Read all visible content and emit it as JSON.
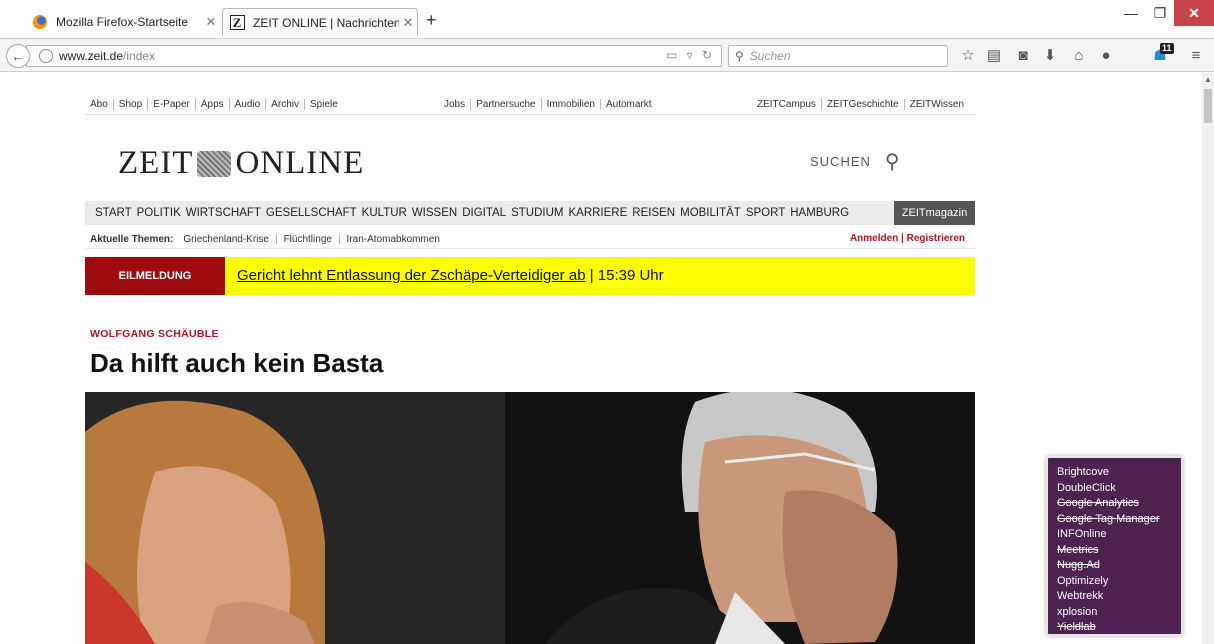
{
  "browser": {
    "tabs": [
      {
        "title": "Mozilla Firefox-Startseite",
        "active": false
      },
      {
        "title": "ZEIT ONLINE | Nachrichten...",
        "active": true
      }
    ],
    "url_host": "www.zeit.de",
    "url_path": "/index",
    "search_placeholder": "Suchen",
    "notification_count": "11",
    "icons": [
      "back-arrow-icon",
      "globe-icon",
      "reader-icon",
      "reload-icon",
      "bookmark-star-icon",
      "bookmarks-list-icon",
      "pocket-icon",
      "download-icon",
      "home-icon",
      "chat-icon",
      "ghostery-icon",
      "menu-icon"
    ]
  },
  "site": {
    "top_links_left": [
      "Abo",
      "Shop",
      "E-Paper",
      "Apps",
      "Audio",
      "Archiv",
      "Spiele"
    ],
    "top_links_middle": [
      "Jobs",
      "Partnersuche",
      "Immobilien",
      "Automarkt"
    ],
    "top_links_right": [
      "ZEITCampus",
      "ZEITGeschichte",
      "ZEITWissen"
    ],
    "logo_left": "ZEIT",
    "logo_right": "ONLINE",
    "search_label": "SUCHEN",
    "sections": [
      "START",
      "POLITIK",
      "WIRTSCHAFT",
      "GESELLSCHAFT",
      "KULTUR",
      "WISSEN",
      "DIGITAL",
      "STUDIUM",
      "KARRIERE",
      "REISEN",
      "MOBILITÄT",
      "SPORT",
      "HAMBURG"
    ],
    "zeitmagazin": "ZEITmagazin",
    "topics_label": "Aktuelle Themen:",
    "topics": [
      "Griechenland-Krise",
      "Flüchtlinge",
      "Iran-Atomabkommen"
    ],
    "login": "Anmelden",
    "login_sep": " | ",
    "register": "Registrieren",
    "breaking_label": "EILMELDUNG",
    "breaking_link": "Gericht lehnt Entlassung der Zschäpe-Verteidiger ab",
    "breaking_time": " | 15:39 Uhr",
    "kicker": "WOLFGANG SCHÄUBLE",
    "headline": "Da hilft auch kein Basta"
  },
  "trackers": [
    {
      "name": "Brightcove",
      "blocked": false
    },
    {
      "name": "DoubleClick",
      "blocked": false
    },
    {
      "name": "Google Analytics",
      "blocked": true
    },
    {
      "name": "Google Tag Manager",
      "blocked": true
    },
    {
      "name": "INFOnline",
      "blocked": false
    },
    {
      "name": "Meetrics",
      "blocked": true
    },
    {
      "name": "Nugg.Ad",
      "blocked": true
    },
    {
      "name": "Optimizely",
      "blocked": false
    },
    {
      "name": "Webtrekk",
      "blocked": false
    },
    {
      "name": "xplosion",
      "blocked": false
    },
    {
      "name": "Yieldlab",
      "blocked": true
    }
  ],
  "colors": {
    "accent_red": "#b5121b",
    "breaking_yellow": "#ffff00",
    "tracker_panel": "#4d2150"
  }
}
